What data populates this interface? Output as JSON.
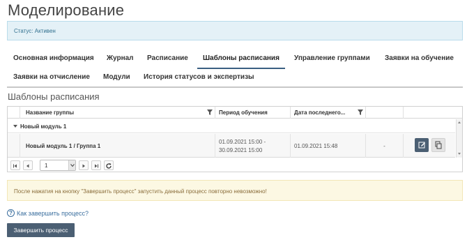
{
  "page": {
    "title": "Моделирование"
  },
  "status": {
    "text": "Статус: Активен"
  },
  "tabs": [
    {
      "label": "Основная информация"
    },
    {
      "label": "Журнал"
    },
    {
      "label": "Расписание"
    },
    {
      "label": "Шаблоны расписания",
      "active": true
    },
    {
      "label": "Управление группами"
    },
    {
      "label": "Заявки на обучение"
    },
    {
      "label": "Заявки на отчисление"
    },
    {
      "label": "Модули"
    },
    {
      "label": "История статусов и экспертизы"
    }
  ],
  "section": {
    "title": "Шаблоны расписания"
  },
  "grid": {
    "columns": [
      {
        "label": "Название группы"
      },
      {
        "label": "Период обучения"
      },
      {
        "label": "Дата последнего..."
      },
      {
        "label": ""
      },
      {
        "label": ""
      }
    ],
    "group": {
      "label": "Новый модуль 1"
    },
    "rows": [
      {
        "name": "Новый модуль 1 / Группа 1",
        "period_start": "01.09.2021 15:00 -",
        "period_end": "30.09.2021 15:00",
        "last_date": "01.09.2021 15:48",
        "extra": "-"
      }
    ],
    "pager": {
      "page": "1"
    }
  },
  "warning": {
    "text": "После нажатия на кнопку \"Завершить процесс\" запустить данный процесс повторно невозможно!"
  },
  "help": {
    "icon": "?",
    "text": "Как завершить процесс?"
  },
  "finish_button": {
    "label": "Завершить процесс"
  },
  "colors": {
    "primary_button": "#4b5f73",
    "info_bg": "#e4f1f7",
    "warning_bg": "#fcf8e3",
    "active_tab_underline": "#3a5f82"
  }
}
